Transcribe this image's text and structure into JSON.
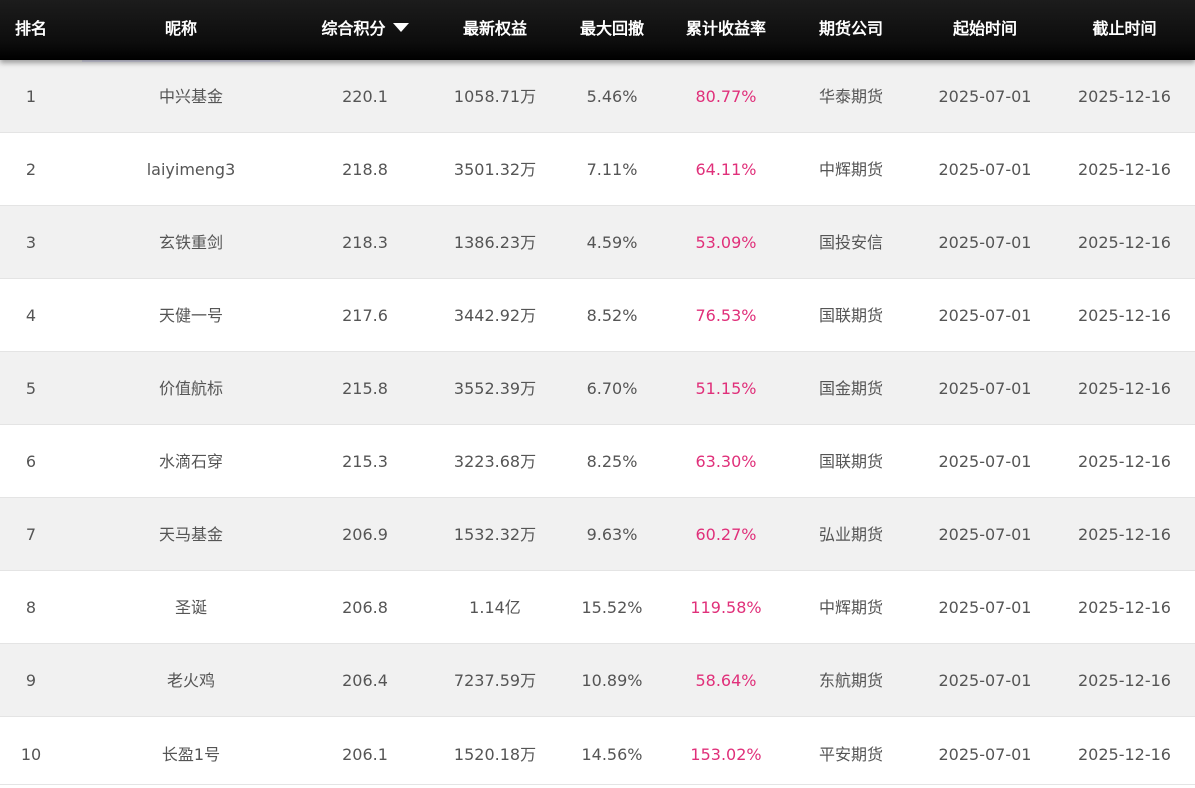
{
  "table": {
    "headers": {
      "rank": "排名",
      "nickname": "昵称",
      "score": "综合积分",
      "equity": "最新权益",
      "max_drawdown": "最大回撤",
      "return_rate": "累计收益率",
      "broker": "期货公司",
      "start_date": "起始时间",
      "end_date": "截止时间"
    },
    "sort_icon": "caret-down-icon",
    "return_color": "#e0307a",
    "rows": [
      {
        "rank": "1",
        "nickname": "中兴基金",
        "score": "220.1",
        "equity": "1058.71万",
        "max_drawdown": "5.46%",
        "return_rate": "80.77%",
        "broker": "华泰期货",
        "start_date": "2025-07-01",
        "end_date": "2025-12-16"
      },
      {
        "rank": "2",
        "nickname": "laiyimeng3",
        "score": "218.8",
        "equity": "3501.32万",
        "max_drawdown": "7.11%",
        "return_rate": "64.11%",
        "broker": "中辉期货",
        "start_date": "2025-07-01",
        "end_date": "2025-12-16"
      },
      {
        "rank": "3",
        "nickname": "玄铁重剑",
        "score": "218.3",
        "equity": "1386.23万",
        "max_drawdown": "4.59%",
        "return_rate": "53.09%",
        "broker": "国投安信",
        "start_date": "2025-07-01",
        "end_date": "2025-12-16"
      },
      {
        "rank": "4",
        "nickname": "天健一号",
        "score": "217.6",
        "equity": "3442.92万",
        "max_drawdown": "8.52%",
        "return_rate": "76.53%",
        "broker": "国联期货",
        "start_date": "2025-07-01",
        "end_date": "2025-12-16"
      },
      {
        "rank": "5",
        "nickname": "价值航标",
        "score": "215.8",
        "equity": "3552.39万",
        "max_drawdown": "6.70%",
        "return_rate": "51.15%",
        "broker": "国金期货",
        "start_date": "2025-07-01",
        "end_date": "2025-12-16"
      },
      {
        "rank": "6",
        "nickname": "水滴石穿",
        "score": "215.3",
        "equity": "3223.68万",
        "max_drawdown": "8.25%",
        "return_rate": "63.30%",
        "broker": "国联期货",
        "start_date": "2025-07-01",
        "end_date": "2025-12-16"
      },
      {
        "rank": "7",
        "nickname": "天马基金",
        "score": "206.9",
        "equity": "1532.32万",
        "max_drawdown": "9.63%",
        "return_rate": "60.27%",
        "broker": "弘业期货",
        "start_date": "2025-07-01",
        "end_date": "2025-12-16"
      },
      {
        "rank": "8",
        "nickname": "圣诞",
        "score": "206.8",
        "equity": "1.14亿",
        "max_drawdown": "15.52%",
        "return_rate": "119.58%",
        "broker": "中辉期货",
        "start_date": "2025-07-01",
        "end_date": "2025-12-16"
      },
      {
        "rank": "9",
        "nickname": "老火鸡",
        "score": "206.4",
        "equity": "7237.59万",
        "max_drawdown": "10.89%",
        "return_rate": "58.64%",
        "broker": "东航期货",
        "start_date": "2025-07-01",
        "end_date": "2025-12-16"
      },
      {
        "rank": "10",
        "nickname": "长盈1号",
        "score": "206.1",
        "equity": "1520.18万",
        "max_drawdown": "14.56%",
        "return_rate": "153.02%",
        "broker": "平安期货",
        "start_date": "2025-07-01",
        "end_date": "2025-12-16"
      }
    ]
  }
}
